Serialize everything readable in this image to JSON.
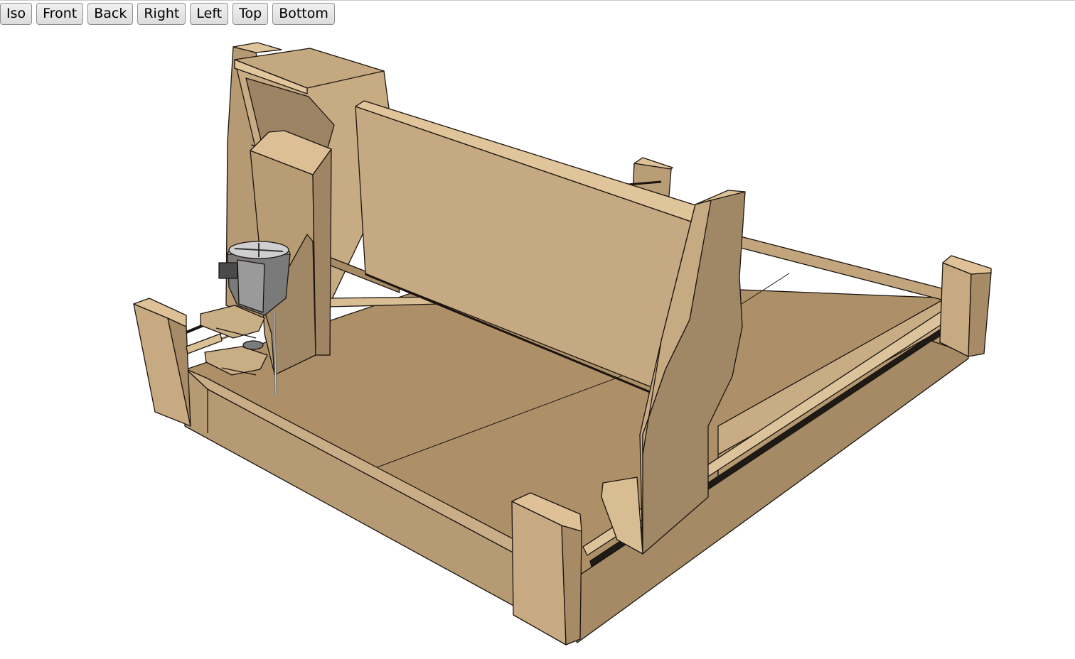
{
  "toolbar": {
    "buttons": [
      {
        "id": "iso",
        "label": "Iso"
      },
      {
        "id": "front",
        "label": "Front"
      },
      {
        "id": "back",
        "label": "Back"
      },
      {
        "id": "right",
        "label": "Right"
      },
      {
        "id": "left",
        "label": "Left"
      },
      {
        "id": "top",
        "label": "Top"
      },
      {
        "id": "bottom",
        "label": "Bottom"
      }
    ]
  },
  "model": {
    "palette": {
      "wood_light": "#e0c49a",
      "wood_mid": "#c6ab85",
      "wood_face": "#b89a72",
      "wood_dark": "#a1896a",
      "wood_shadow": "#8e7557",
      "edge": "#1a1410",
      "metal_light": "#a8a8a8",
      "metal_dark": "#5a5a5a"
    }
  }
}
